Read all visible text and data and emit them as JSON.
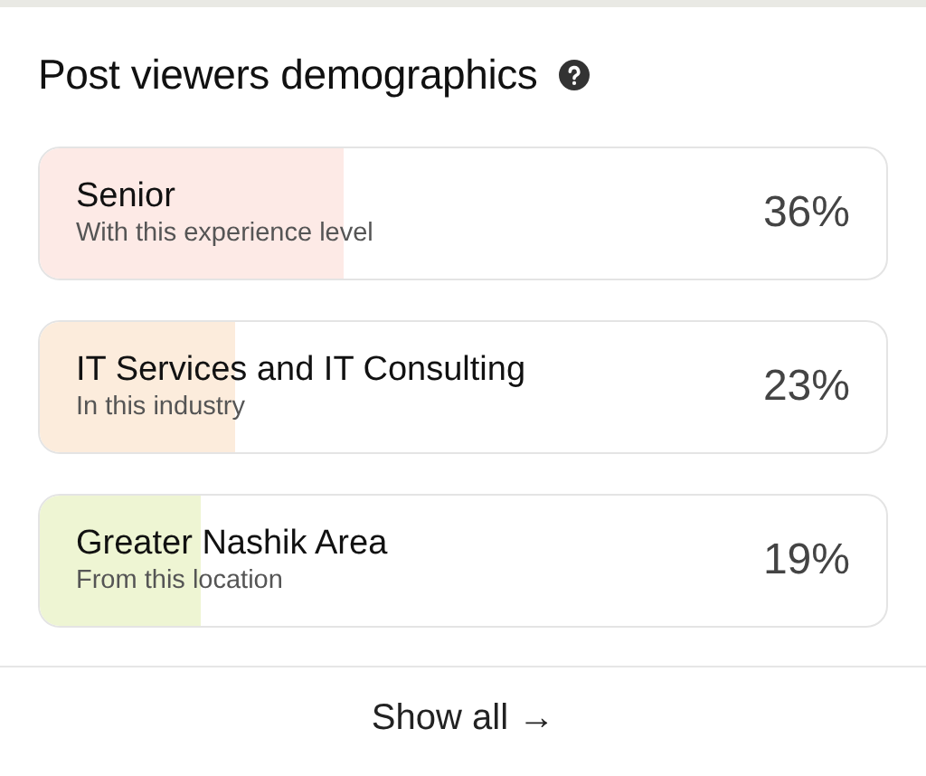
{
  "title": "Post viewers demographics",
  "items": [
    {
      "name": "Senior",
      "caption": "With this experience level",
      "value": "36%",
      "level": 0.36,
      "color": "#fdeae6"
    },
    {
      "name": "IT Services and IT Consulting",
      "caption": "In this industry",
      "value": "23%",
      "level": 0.23,
      "color": "#fcecdc"
    },
    {
      "name": "Greater Nashik Area",
      "caption": "From this location",
      "value": "19%",
      "level": 0.19,
      "color": "#eef5d3"
    }
  ],
  "footer": {
    "label": "Show all →"
  }
}
